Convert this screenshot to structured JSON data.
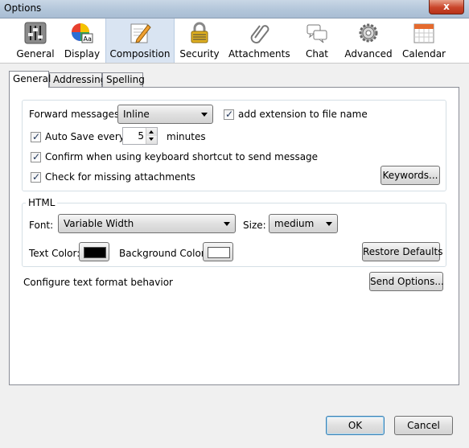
{
  "window": {
    "title": "Options",
    "close_label": "x"
  },
  "toolbar": {
    "panes": [
      {
        "label": "General",
        "icon": "sliders-icon"
      },
      {
        "label": "Display",
        "icon": "display-palette-icon"
      },
      {
        "label": "Composition",
        "icon": "pencil-paper-icon",
        "selected": true
      },
      {
        "label": "Security",
        "icon": "padlock-icon"
      },
      {
        "label": "Attachments",
        "icon": "paperclip-icon"
      },
      {
        "label": "Chat",
        "icon": "chat-bubbles-icon"
      },
      {
        "label": "Advanced",
        "icon": "gear-icon"
      },
      {
        "label": "Calendar",
        "icon": "calendar-icon"
      }
    ]
  },
  "tabs": [
    {
      "label": "General",
      "active": true
    },
    {
      "label": "Addressing"
    },
    {
      "label": "Spelling"
    }
  ],
  "forwarding": {
    "forward_label": "Forward messages:",
    "forward_value": "Inline",
    "add_extension_label": "add extension to file name",
    "add_extension_checked": true,
    "autosave_label": "Auto Save every",
    "autosave_value": "5",
    "autosave_unit": "minutes",
    "autosave_checked": true,
    "confirm_label": "Confirm when using keyboard shortcut to send message",
    "confirm_checked": true,
    "missing_label": "Check for missing attachments",
    "missing_checked": true,
    "keywords_button": "Keywords..."
  },
  "html": {
    "legend": "HTML",
    "font_label": "Font:",
    "font_value": "Variable Width",
    "size_label": "Size:",
    "size_value": "medium",
    "text_color_label": "Text Color:",
    "text_color": "#000000",
    "background_color_label": "Background Color:",
    "background_color": "#ffffff",
    "restore_button": "Restore Defaults"
  },
  "send_format": {
    "label": "Configure text format behavior",
    "button": "Send Options..."
  },
  "footer": {
    "ok": "OK",
    "cancel": "Cancel"
  }
}
